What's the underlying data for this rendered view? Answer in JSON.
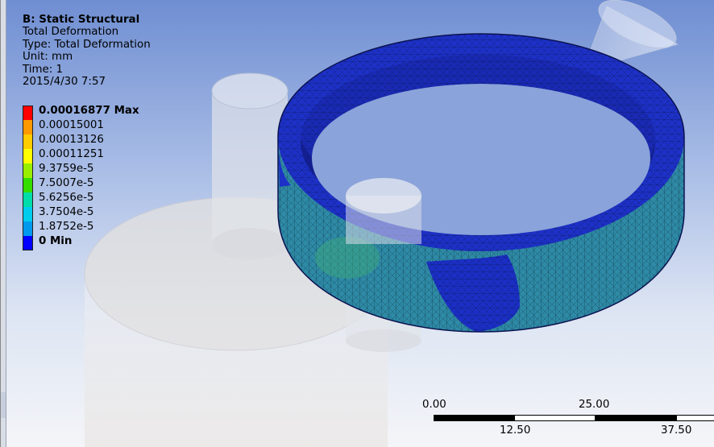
{
  "result": {
    "system": "B: Static Structural",
    "name": "Total Deformation",
    "type": "Type: Total Deformation",
    "unit": "Unit: mm",
    "time": "Time: 1",
    "date": "2015/4/30 7:57"
  },
  "legend": [
    {
      "label": "0.00016877 Max",
      "color": "#ff0000",
      "bold": true
    },
    {
      "label": "0.00015001",
      "color": "#ff9900",
      "bold": false
    },
    {
      "label": "0.00013126",
      "color": "#ffcc00",
      "bold": false
    },
    {
      "label": "0.00011251",
      "color": "#ffff00",
      "bold": false
    },
    {
      "label": "9.3759e-5",
      "color": "#99ee00",
      "bold": false
    },
    {
      "label": "7.5007e-5",
      "color": "#33dd00",
      "bold": false
    },
    {
      "label": "5.6256e-5",
      "color": "#00ddaa",
      "bold": false
    },
    {
      "label": "3.7504e-5",
      "color": "#00ccee",
      "bold": false
    },
    {
      "label": "1.8752e-5",
      "color": "#0099ee",
      "bold": false
    },
    {
      "label": "0 Min",
      "color": "#0000ff",
      "bold": true
    }
  ],
  "scale_bar": {
    "top_labels": [
      "0.00",
      "25.00"
    ],
    "bottom_labels": [
      "12.50",
      "37.50"
    ]
  },
  "colors": {
    "mesh_high": "#1a2fd0",
    "mesh_mid": "#2b8aa6",
    "ghost_parts": "#d9dbe0"
  }
}
